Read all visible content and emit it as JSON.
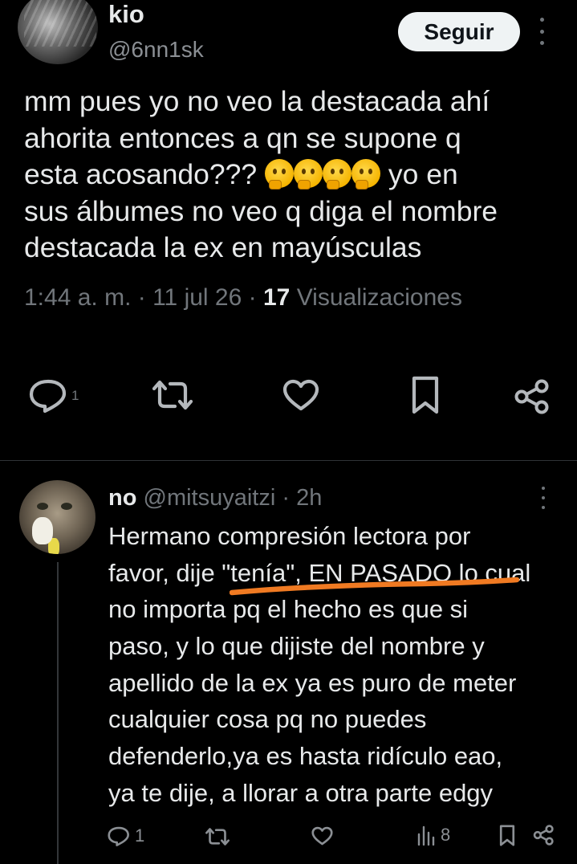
{
  "tweet": {
    "author": {
      "display_name": "kio",
      "handle": "@6nn1sk"
    },
    "follow_label": "Seguir",
    "text_lines": [
      "mm pues yo no veo la destacada ahí",
      "ahorita entonces a qn se supone q",
      "esta acosando???",
      "yo en",
      "sus álbumes no veo q diga el nombre",
      "destacada la ex en mayúsculas"
    ],
    "emoji": "thinking-face",
    "emoji_count": 4,
    "meta": {
      "time": "1:44 a. m.",
      "separator": "·",
      "date": "11 jul 26",
      "views_count": "17",
      "views_label": "Visualizaciones"
    },
    "actions": {
      "reply_count": "1"
    }
  },
  "reply": {
    "author": {
      "display_name": "no",
      "handle": "@mitsuyaitzi",
      "separator": "·",
      "age": "2h"
    },
    "text_lines": [
      "Hermano compresión lectora por",
      "favor, dije \"tenía\", EN PASADO lo cual",
      "no importa pq el hecho es que si",
      "paso, y lo que dijiste del nombre y",
      "apellido de la ex ya es puro de meter",
      "cualquier cosa pq no puedes",
      "defenderlo,ya es hasta ridículo eao,",
      "ya te dije, a llorar a otra parte edgy"
    ],
    "annotation_color": "#f07a22",
    "actions": {
      "reply_count": "1",
      "views_count": "8"
    }
  },
  "icons": {
    "reply": "reply-icon",
    "repost": "repost-icon",
    "like": "heart-icon",
    "bookmark": "bookmark-icon",
    "share": "share-icon",
    "views": "views-icon",
    "more": "more-icon"
  }
}
